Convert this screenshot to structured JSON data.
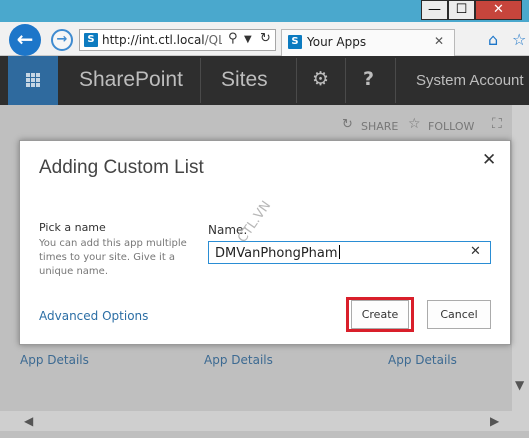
{
  "browser": {
    "address_url_host": "http://int.ctl.local",
    "address_url_rest": "/QLM",
    "tab_title": "Your Apps",
    "favicon_letter": "S"
  },
  "window_controls": {
    "minimize": "—",
    "maximize": "☐",
    "close": "✕"
  },
  "suitebar": {
    "brand": "SharePoint",
    "sites": "Sites",
    "settings_icon": "⚙",
    "help_icon": "?",
    "user": "System Account"
  },
  "page": {
    "share_label": "SHARE",
    "follow_label": "FOLLOW",
    "app_details": [
      "App Details",
      "App Details",
      "App Details"
    ]
  },
  "dialog": {
    "title": "Adding Custom List",
    "pick_heading": "Pick a name",
    "pick_description": "You can add this app multiple times to your site. Give it a unique name.",
    "name_label": "Name:",
    "name_value": "DMVanPhongPham",
    "watermark": "CTL.VN",
    "advanced_link": "Advanced Options",
    "create_label": "Create",
    "cancel_label": "Cancel",
    "highlight_color": "#d91f2a"
  }
}
